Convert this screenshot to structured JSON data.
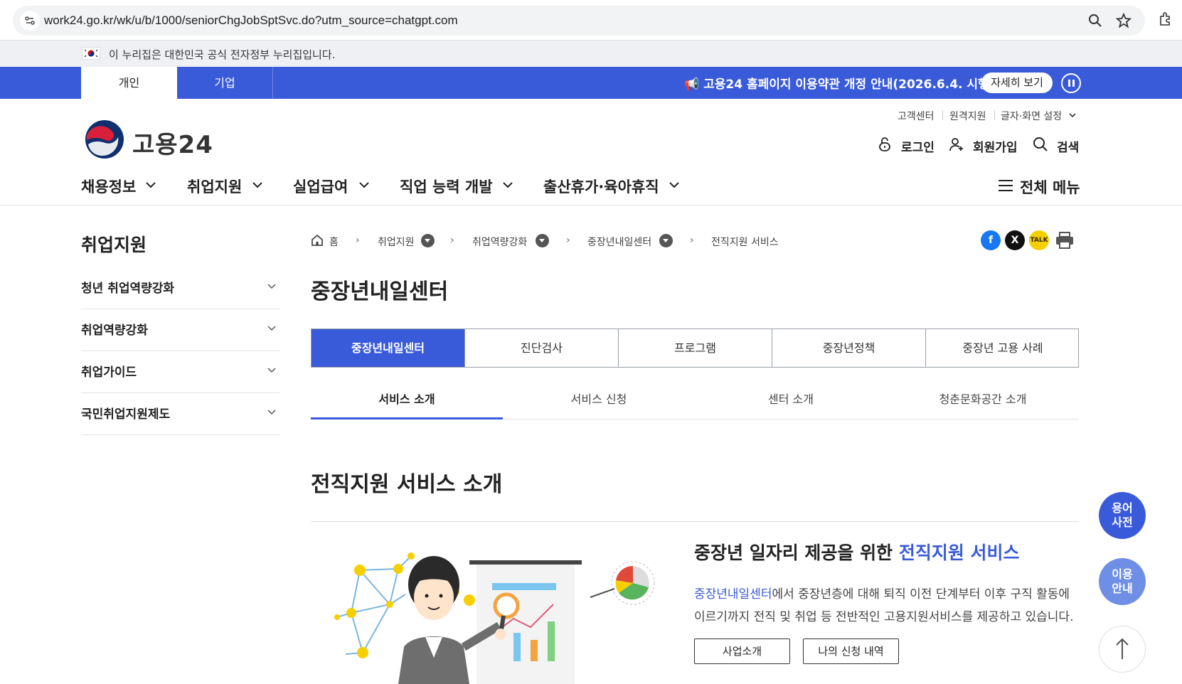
{
  "browser": {
    "url": "work24.go.kr/wk/u/b/1000/seniorChgJobSptSvc.do?utm_source=chatgpt.com"
  },
  "gov_banner": {
    "text": "이 누리집은 대한민국 공식 전자정부 누리집입니다."
  },
  "top_bar": {
    "tabs": [
      "개인",
      "기업"
    ],
    "notice": "📢 고용24 홈페이지 이용약관 개정 안내(2026.6.4. 시행)",
    "notice_button": "자세히 보기"
  },
  "header": {
    "logo_text": "고용24",
    "util_links": [
      "고객센터",
      "원격지원",
      "글자·화면 설정"
    ],
    "login": "로그인",
    "signup": "회원가입",
    "search": "검색"
  },
  "gnb": {
    "items": [
      "채용정보",
      "취업지원",
      "실업급여",
      "직업 능력 개발",
      "출산휴가·육아휴직"
    ],
    "all_menu": "전체 메뉴"
  },
  "lnb": {
    "title": "취업지원",
    "items": [
      "청년 취업역량강화",
      "취업역량강화",
      "취업가이드",
      "국민취업지원제도"
    ]
  },
  "breadcrumb": {
    "home": "홈",
    "items": [
      "취업지원",
      "취업역량강화",
      "중장년내일센터",
      "전직지원 서비스"
    ]
  },
  "page_title": "중장년내일센터",
  "tabs": [
    "중장년내일센터",
    "진단검사",
    "프로그램",
    "중장년정책",
    "중장년 고용 사례"
  ],
  "subtabs": [
    "서비스 소개",
    "서비스 신청",
    "센터 소개",
    "청춘문화공간 소개"
  ],
  "section": {
    "title": "전직지원 서비스 소개",
    "lead_prefix": "중장년 일자리 제공을 위한 ",
    "lead_highlight": "전직지원 서비스",
    "desc_highlight": "중장년내일센터",
    "desc1_rest": "에서 중장년층에 대해 퇴직 이전 단계부터 이후 구직 활동에",
    "desc2": "이르기까지 전직 및 취업 등 전반적인 고용지원서비스를 제공하고 있습니다.",
    "buttons": [
      "사업소개",
      "나의 신청 내역"
    ]
  },
  "floating": {
    "glossary": "용어\n사전",
    "guide": "이용\n안내"
  },
  "colors": {
    "brand_blue": "#3a5bd9",
    "float_dark": "#3a5bd9",
    "float_light": "#6f8fe6"
  }
}
